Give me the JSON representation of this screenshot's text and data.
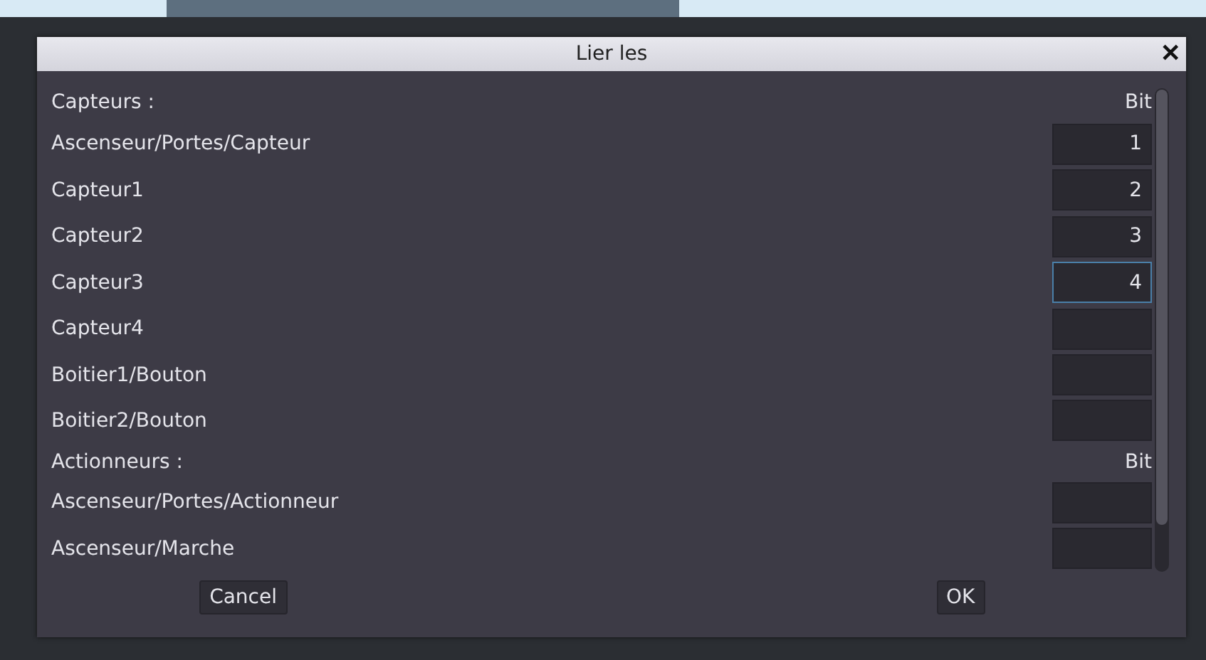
{
  "dialog": {
    "title": "Lier les",
    "close": "✕"
  },
  "sections": [
    {
      "heading": "Capteurs :",
      "column": "Bit",
      "rows": [
        {
          "label": "Ascenseur/Portes/Capteur",
          "value": "1",
          "focused": false
        },
        {
          "label": "Capteur1",
          "value": "2",
          "focused": false
        },
        {
          "label": "Capteur2",
          "value": "3",
          "focused": false
        },
        {
          "label": "Capteur3",
          "value": "4",
          "focused": true
        },
        {
          "label": "Capteur4",
          "value": "",
          "focused": false
        },
        {
          "label": "Boitier1/Bouton",
          "value": "",
          "focused": false
        },
        {
          "label": "Boitier2/Bouton",
          "value": "",
          "focused": false
        }
      ]
    },
    {
      "heading": "Actionneurs :",
      "column": "Bit",
      "rows": [
        {
          "label": "Ascenseur/Portes/Actionneur",
          "value": "",
          "focused": false
        },
        {
          "label": "Ascenseur/Marche",
          "value": "",
          "focused": false
        }
      ]
    }
  ],
  "buttons": [
    "Cancel",
    "OK"
  ]
}
